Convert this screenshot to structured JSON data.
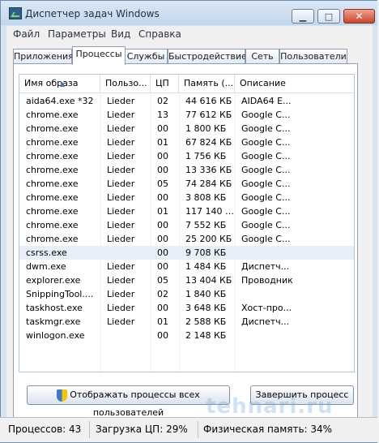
{
  "window": {
    "title": "Диспетчер задач Windows",
    "buttons": {
      "minimize": "▁",
      "maximize": "□",
      "close": "✕"
    }
  },
  "menubar": {
    "items": [
      "Файл",
      "Параметры",
      "Вид",
      "Справка"
    ]
  },
  "tabs": [
    "Приложения",
    "Процессы",
    "Службы",
    "Быстродействие",
    "Сеть",
    "Пользователи"
  ],
  "table": {
    "headers": [
      "Имя образа",
      "Пользо...",
      "ЦП",
      "Память (...",
      "Описание"
    ],
    "rows": [
      [
        "aida64.exe *32",
        "Lieder",
        "02",
        "44 616 КБ",
        "AIDA64 E..."
      ],
      [
        "chrome.exe",
        "Lieder",
        "13",
        "77 612 КБ",
        "Google C..."
      ],
      [
        "chrome.exe",
        "Lieder",
        "00",
        "1 800 КБ",
        "Google C..."
      ],
      [
        "chrome.exe",
        "Lieder",
        "01",
        "67 824 КБ",
        "Google C..."
      ],
      [
        "chrome.exe",
        "Lieder",
        "00",
        "1 756 КБ",
        "Google C..."
      ],
      [
        "chrome.exe",
        "Lieder",
        "00",
        "13 336 КБ",
        "Google C..."
      ],
      [
        "chrome.exe",
        "Lieder",
        "05",
        "74 284 КБ",
        "Google C..."
      ],
      [
        "chrome.exe",
        "Lieder",
        "00",
        "3 808 КБ",
        "Google C..."
      ],
      [
        "chrome.exe",
        "Lieder",
        "01",
        "117 140 КБ",
        "Google C..."
      ],
      [
        "chrome.exe",
        "Lieder",
        "00",
        "7 552 КБ",
        "Google C..."
      ],
      [
        "chrome.exe",
        "Lieder",
        "00",
        "25 200 КБ",
        "Google C..."
      ],
      [
        "csrss.exe",
        "",
        "00",
        "9 708 КБ",
        ""
      ],
      [
        "dwm.exe",
        "Lieder",
        "00",
        "1 484 КБ",
        "Диспетч..."
      ],
      [
        "explorer.exe",
        "Lieder",
        "05",
        "13 404 КБ",
        "Проводник"
      ],
      [
        "SnippingTool....",
        "Lieder",
        "02",
        "1 840 КБ",
        ""
      ],
      [
        "taskhost.exe",
        "Lieder",
        "00",
        "3 648 КБ",
        "Хост-про..."
      ],
      [
        "taskmgr.exe",
        "Lieder",
        "01",
        "2 588 КБ",
        "Диспетч..."
      ],
      [
        "winlogon.exe",
        "",
        "00",
        "2 148 КБ",
        ""
      ]
    ]
  },
  "buttons": {
    "show_all": "Отображать процессы всех пользователей",
    "end_process": "Завершить процесс"
  },
  "status": {
    "processes": "Процессов: 43",
    "cpu": "Загрузка ЦП: 29%",
    "memory": "Физическая память: 34%"
  },
  "watermark": "tehnari.ru"
}
